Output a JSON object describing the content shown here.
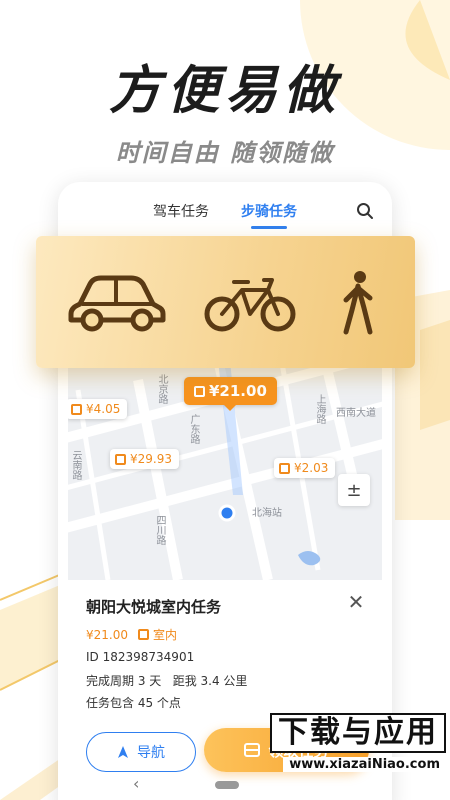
{
  "headline": {
    "title": "方便易做",
    "subtitle": "时间自由 随领随做"
  },
  "tabs": [
    {
      "label": "驾车任务",
      "active": false
    },
    {
      "label": "步骑任务",
      "active": true
    }
  ],
  "map": {
    "price_tags": [
      {
        "label": "¥4.05",
        "icon": "task-icon"
      },
      {
        "label": "¥21.00",
        "icon": "door-icon",
        "highlighted": true
      },
      {
        "label": "¥29.93",
        "icon": "bus-icon"
      },
      {
        "label": "¥2.03",
        "icon": "door-icon"
      }
    ],
    "roads": [
      "北京路",
      "广东路",
      "上海路",
      "西南大道",
      "云南路",
      "四川路",
      "北海站"
    ],
    "zoom_label": "±"
  },
  "modes": [
    {
      "name": "car-icon"
    },
    {
      "name": "bicycle-icon"
    },
    {
      "name": "pedestrian-icon"
    }
  ],
  "task": {
    "name": "朝阳大悦城室内任务",
    "price": "¥21.00",
    "location_type": "室内",
    "id": "ID 182398734901",
    "period_distance": "完成周期 3 天   距我 3.4 公里",
    "points": "任务包含 45 个点"
  },
  "buttons": {
    "navigate": "导航",
    "claim": "领取任务"
  },
  "watermark": {
    "main": "下载与应用",
    "url": "www.xiazaiNiao.com"
  },
  "colors": {
    "accent": "#2f7ff0",
    "orange": "#f7931e",
    "gold": "#f1c777"
  }
}
